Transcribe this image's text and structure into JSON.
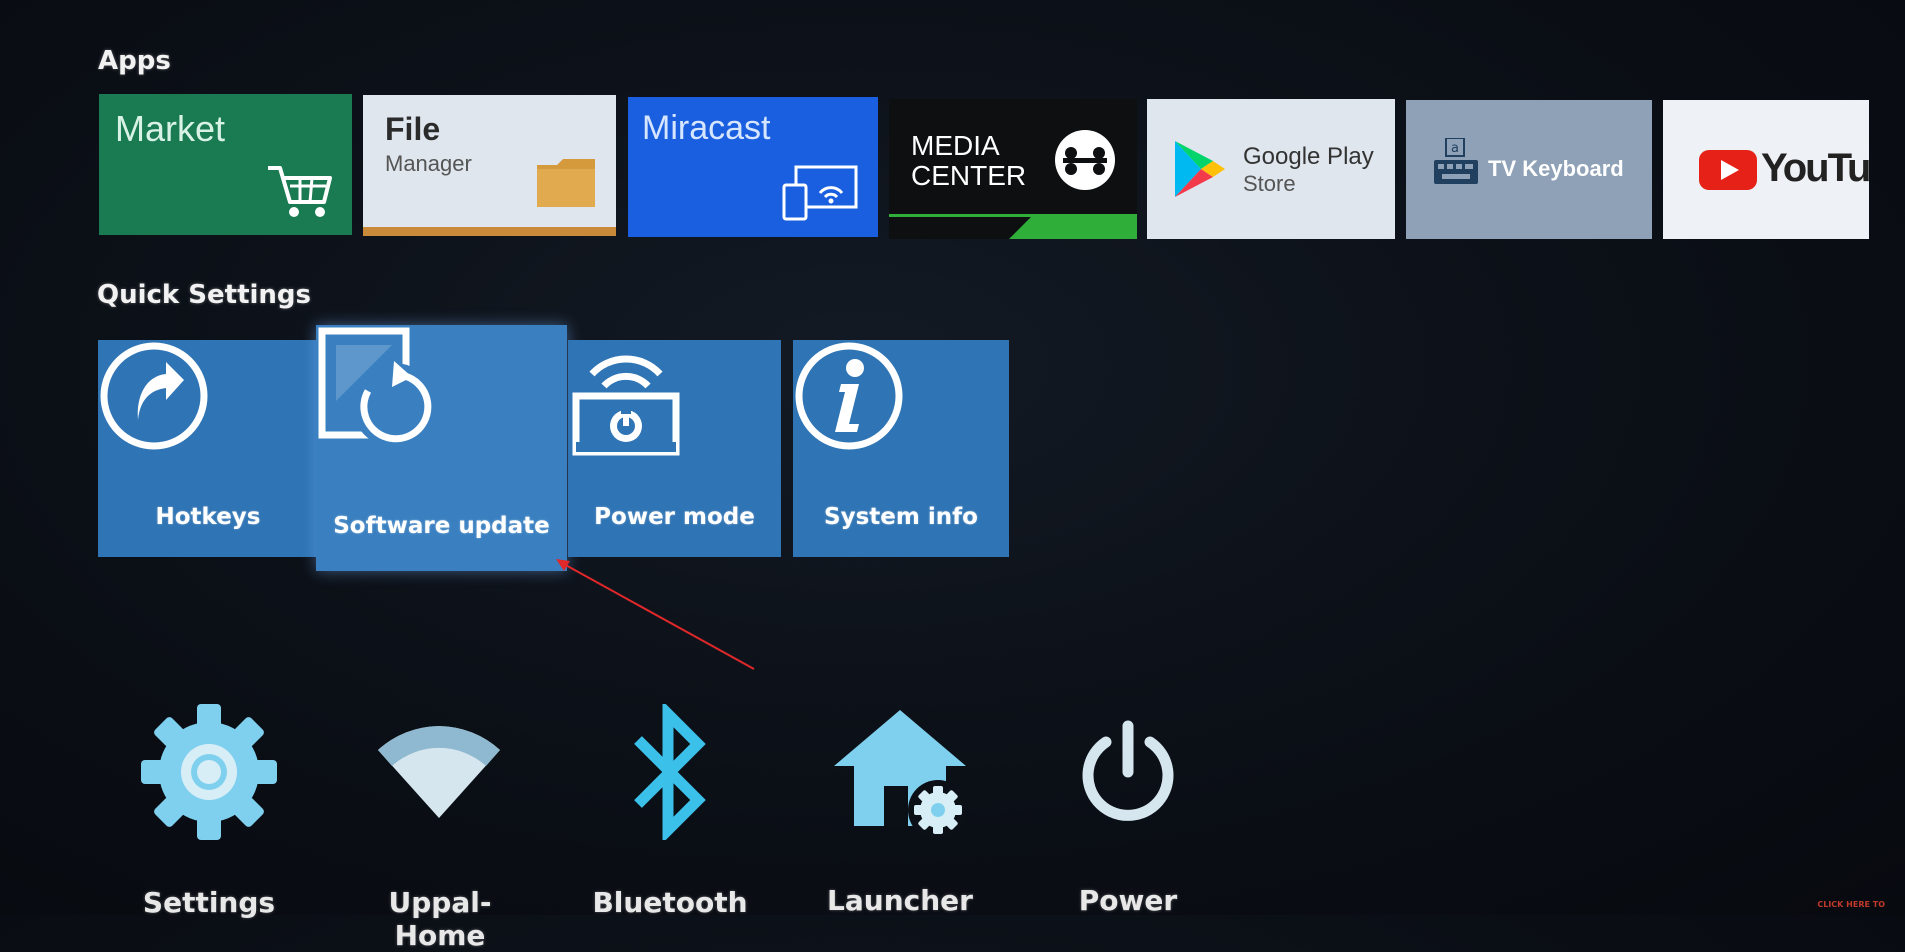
{
  "sections": {
    "apps_title": "Apps",
    "quick_settings_title": "Quick Settings"
  },
  "apps": {
    "market": {
      "label": "Market"
    },
    "file_manager": {
      "line1": "File",
      "line2": "Manager"
    },
    "miracast": {
      "label": "Miracast"
    },
    "media_center": {
      "line1": "MEDIA",
      "line2": "CENTER"
    },
    "google_play": {
      "line1": "Google Play",
      "line2": "Store"
    },
    "tv_keyboard": {
      "label": "TV Keyboard"
    },
    "youtube": {
      "label": "YouTube"
    }
  },
  "quick_settings": {
    "hotkeys": "Hotkeys",
    "software_update": "Software update",
    "power_mode": "Power mode",
    "system_info": "System info"
  },
  "bottom": {
    "settings": "Settings",
    "wifi": "Uppal-Home",
    "bluetooth": "Bluetooth",
    "launcher": "Launcher",
    "power": "Power"
  },
  "hint": "CLICK HERE TO",
  "colors": {
    "market_bg": "#1a7a52",
    "file_manager_bg": "#dfe6ee",
    "miracast_bg": "#1a5fe0",
    "media_center_bg": "#0d0f10",
    "quick_tile_bg": "#2f74b4",
    "icon_cyan": "#5ec8ec",
    "annotation_arrow": "#e0282a"
  },
  "icons": [
    "cart-icon",
    "folder-icon",
    "cast-icon",
    "media-center-icon",
    "play-store-icon",
    "keyboard-icon",
    "youtube-icon",
    "hotkey-arrow-icon",
    "update-icon",
    "power-mode-icon",
    "info-icon",
    "gear-icon",
    "wifi-icon",
    "bluetooth-icon",
    "launcher-home-icon",
    "power-icon"
  ]
}
